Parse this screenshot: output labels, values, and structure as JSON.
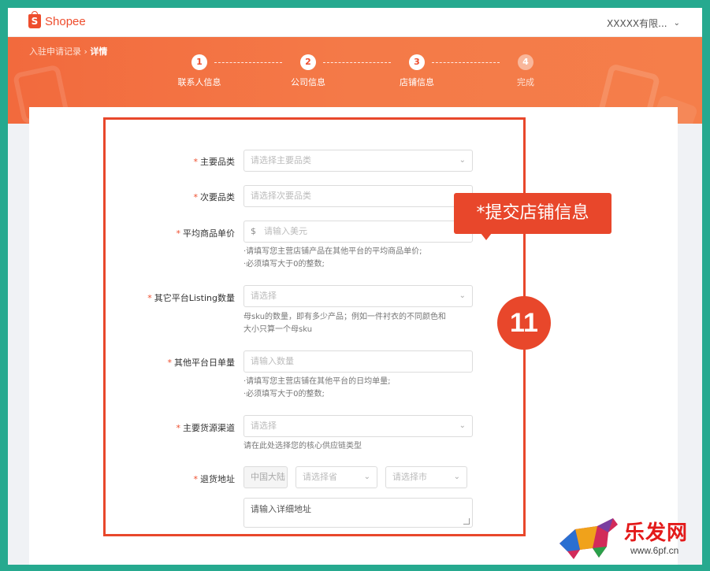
{
  "header": {
    "logo_text": "Shopee",
    "logo_glyph": "S",
    "account_label": "XXXXX有限...",
    "account_chevron": "⌄"
  },
  "banner": {
    "breadcrumb_link": "入驻申请记录",
    "breadcrumb_sep": " › ",
    "breadcrumb_current": "详情",
    "steps": [
      {
        "number": "1",
        "label": "联系人信息",
        "status": "done"
      },
      {
        "number": "2",
        "label": "公司信息",
        "status": "done"
      },
      {
        "number": "3",
        "label": "店铺信息",
        "status": "current"
      },
      {
        "number": "4",
        "label": "完成",
        "status": "todo"
      }
    ]
  },
  "form": {
    "required_mark": "*",
    "main_category": {
      "label": "主要品类",
      "placeholder": "请选择主要品类"
    },
    "sub_category": {
      "label": "次要品类",
      "placeholder": "请选择次要品类"
    },
    "avg_price": {
      "label": "平均商品单价",
      "prefix": "$",
      "placeholder": "请输入美元",
      "help_1": "·请填写您主营店铺产品在其他平台的平均商品单价;",
      "help_2": "·必须填写大于0的整数;"
    },
    "listing_count": {
      "label": "其它平台Listing数量",
      "placeholder": "请选择",
      "help_1": "母sku的数量，即有多少产品；例如一件衬衣的不同颜色和",
      "help_2": "大小只算一个母sku"
    },
    "daily_orders": {
      "label": "其他平台日单量",
      "placeholder": "请输入数量",
      "help_1": "·请填写您主营店铺在其他平台的日均单量;",
      "help_2": "·必须填写大于0的整数;"
    },
    "supply_channel": {
      "label": "主要货源渠道",
      "placeholder": "请选择",
      "help": "请在此处选择您的核心供应链类型"
    },
    "return_address": {
      "label": "退货地址",
      "country": "中国大陆",
      "province_placeholder": "请选择省",
      "city_placeholder": "请选择市",
      "detail_placeholder": "请输入详细地址"
    }
  },
  "annotation": {
    "tooltip": "*提交店铺信息",
    "badge": "11"
  },
  "watermark": {
    "text": "乐发网",
    "url": "www.6pf.cn"
  },
  "colors": {
    "brand": "#ee4d2d",
    "annotation": "#e8472b",
    "frame": "#26a98f"
  }
}
